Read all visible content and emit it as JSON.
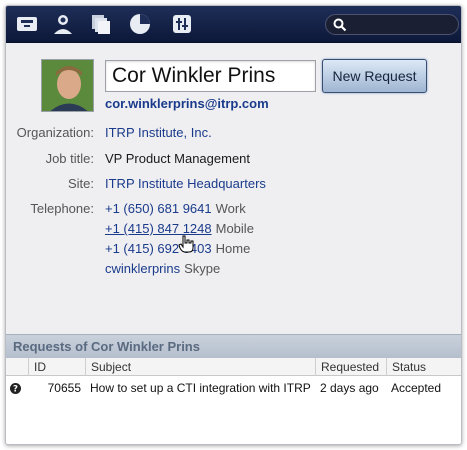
{
  "toolbar": {
    "icons": [
      "inbox-icon",
      "people-icon",
      "pages-icon",
      "pie-chart-icon",
      "tools-icon"
    ],
    "search": {
      "value": "",
      "placeholder": ""
    }
  },
  "profile": {
    "name": "Cor Winkler Prins",
    "new_request_label": "New Request",
    "email": "cor.winklerprins@itrp.com"
  },
  "details": {
    "organization_label": "Organization:",
    "organization": "ITRP Institute, Inc.",
    "job_title_label": "Job title:",
    "job_title": "VP Product Management",
    "site_label": "Site:",
    "site": "ITRP Institute Headquarters",
    "telephone_label": "Telephone:",
    "phones": [
      {
        "number": "+1 (650) 681 9641",
        "type": "Work"
      },
      {
        "number": "+1 (415) 847 1248",
        "type": "Mobile"
      },
      {
        "number": "+1 (415) 692 3403",
        "type": "Home"
      },
      {
        "number": "cwinklerprins",
        "type": "Skype"
      }
    ]
  },
  "requests": {
    "title": "Requests of Cor Winkler Prins",
    "columns": [
      "ID",
      "Subject",
      "Requested",
      "Status"
    ],
    "rows": [
      {
        "id": "70655",
        "subject": "How to set up a CTI integration with ITRP",
        "requested": "2 days ago",
        "status": "Accepted"
      }
    ]
  },
  "colors": {
    "toolbar": "#0d1839",
    "link": "#1a3b8c",
    "panel_header": "#b5bfcc"
  }
}
